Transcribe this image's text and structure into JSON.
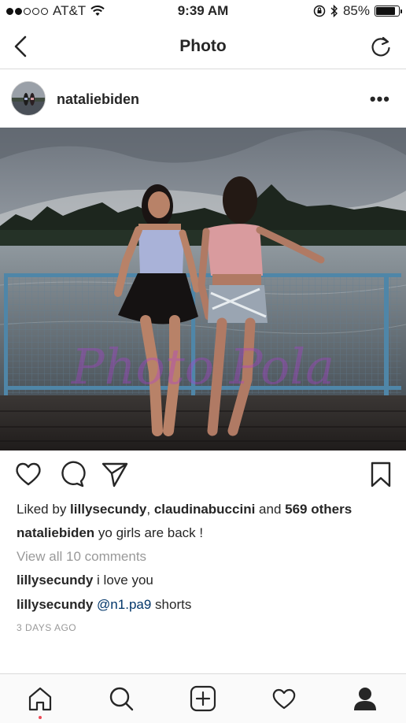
{
  "status_bar": {
    "carrier": "AT&T",
    "time": "9:39 AM",
    "battery": "85%"
  },
  "nav": {
    "title": "Photo"
  },
  "post": {
    "username": "nataliebiden",
    "more_label": "•••",
    "photo_watermark": "Photo Pola",
    "likes": {
      "prefix": "Liked by ",
      "user1": "lillysecundy",
      "sep": ", ",
      "user2": "claudinabuccini",
      "and": " and ",
      "others": "569 others"
    },
    "caption": {
      "user": "nataliebiden",
      "text": " yo girls are back !"
    },
    "view_all_comments": "View all 10 comments",
    "comments": [
      {
        "user": "lillysecundy",
        "text": " i love you",
        "mention": ""
      },
      {
        "user": "lillysecundy",
        "text": " shorts",
        "mention": " @n1.pa9"
      }
    ],
    "time_ago": "3 DAYS AGO"
  },
  "icons": {
    "nav_back": "chevron-left-icon",
    "nav_refresh": "refresh-icon",
    "like": "heart-icon",
    "comment": "comment-icon",
    "share": "send-icon",
    "save": "bookmark-icon",
    "tabs": [
      "home-icon",
      "search-icon",
      "add-icon",
      "activity-heart-icon",
      "profile-icon"
    ]
  },
  "colors": {
    "text": "#262626",
    "muted": "#999999",
    "mention": "#003569",
    "notification_dot": "#ed4956",
    "divider": "#dbdbdb"
  }
}
